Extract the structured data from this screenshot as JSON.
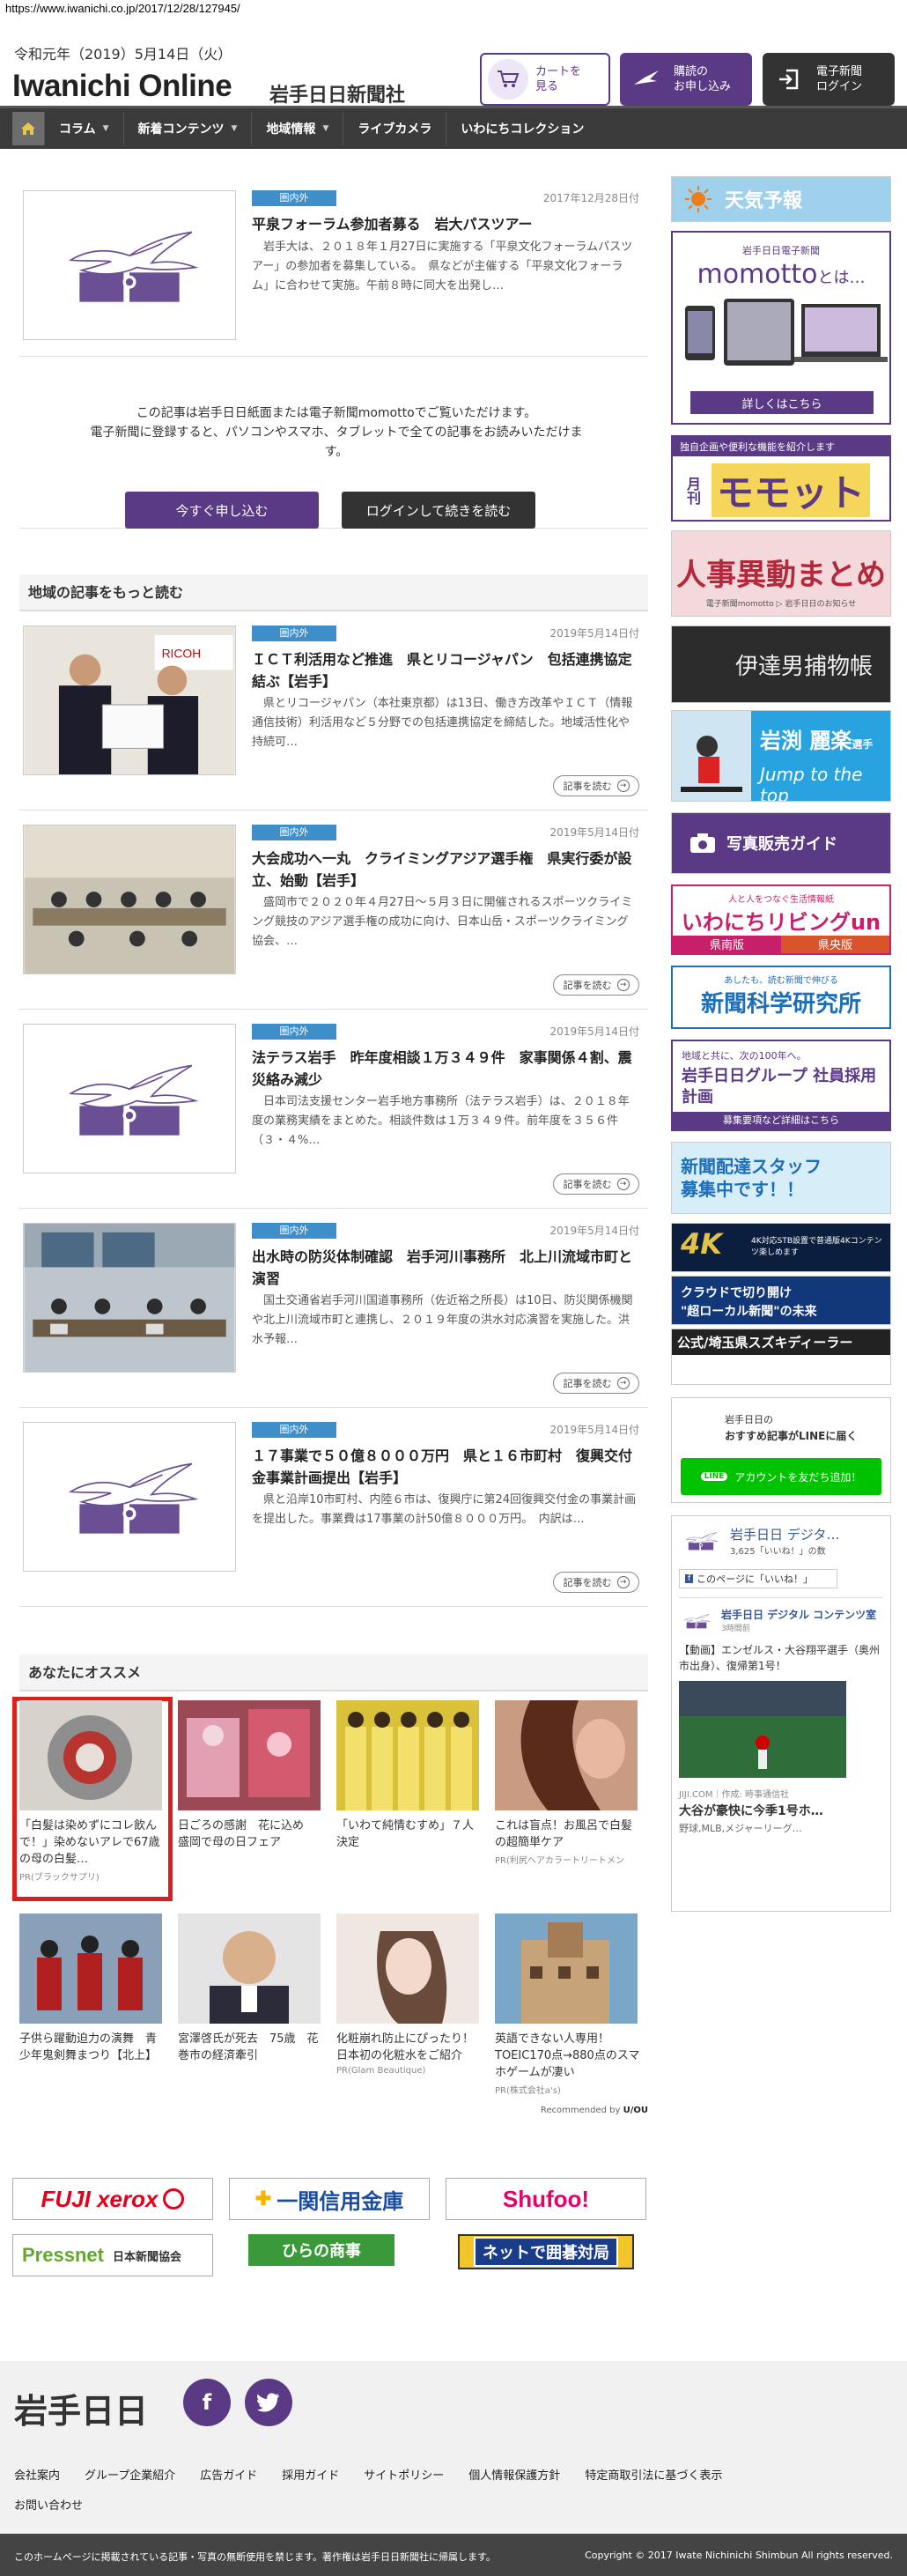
{
  "url": "https://www.iwanichi.co.jp/2017/12/28/127945/",
  "header": {
    "date": "令和元年（2019）5月14日（火）",
    "logo": "Iwanichi Online",
    "logo_sub": "岩手日日新聞社",
    "cart": "カートを\n見る",
    "subscribe": "購読の\nお申し込み",
    "login": "電子新聞\nログイン"
  },
  "nav": {
    "items": [
      {
        "label": "コラム",
        "drop": "▼"
      },
      {
        "label": "新着コンテンツ",
        "drop": "▼"
      },
      {
        "label": "地域情報",
        "drop": "▼"
      },
      {
        "label": "ライブカメラ",
        "drop": ""
      },
      {
        "label": "いわにちコレクション",
        "drop": ""
      }
    ]
  },
  "top_article": {
    "tag": "圏内外",
    "date": "2017年12月28日付",
    "title": "平泉フォーラム参加者募る　岩大パスツアー",
    "body": "岩手大は、２０１８年１月27日に実施する「平泉文化フォーラムパスツアー」の参加者を募集している。　県などが主催する「平泉文化フォーラム」に合わせて実施。午前８時に同大を出発し…"
  },
  "paywall": {
    "text": "この記事は岩手日日紙面または電子新聞momottoでご覧いただけます。\n電子新聞に登録すると、パソコンやスマホ、タブレットで全ての記事をお読みいただけます。",
    "subscribe_btn": "今すぐ申し込む",
    "login_btn": "ログインして続きを読む"
  },
  "region": {
    "heading": "地域の記事をもっと読む",
    "more_label": "記事を読む",
    "articles": [
      {
        "tag": "圏内外",
        "date": "2019年5月14日付",
        "title": "ＩＣＴ利活用など推進　県とリコージャパン　包括連携協定結ぶ【岩手】",
        "body": "県とリコージャパン（本社東京都）は13日、働き方改革やＩＣＴ（情報通信技術）利活用など５分野での包括連携協定を締結した。地域活性化や持続可…"
      },
      {
        "tag": "圏内外",
        "date": "2019年5月14日付",
        "title": "大会成功へ一丸　クライミングアジア選手権　県実行委が設立、始動【岩手】",
        "body": "盛岡市で２０２０年４月27日～５月３日に開催されるスポーツクライミング競技のアジア選手権の成功に向け、日本山岳・スポーツクライミング協会、…"
      },
      {
        "tag": "圏内外",
        "date": "2019年5月14日付",
        "title": "法テラス岩手　昨年度相談１万３４９件　家事関係４割、震災絡み減少",
        "body": "日本司法支援センター岩手地方事務所（法テラス岩手）は、２０１８年度の業務実績をまとめた。相談件数は１万３４９件。前年度を３５６件（３・４%…"
      },
      {
        "tag": "圏内外",
        "date": "2019年5月14日付",
        "title": "出水時の防災体制確認　岩手河川事務所　北上川流域市町と演習",
        "body": "国土交通省岩手河川国道事務所（佐近裕之所長）は10日、防災関係機関や北上川流域市町と連携し、２０１９年度の洪水対応演習を実施した。洪水予報…"
      },
      {
        "tag": "圏内外",
        "date": "2019年5月14日付",
        "title": "１７事業で５０億８０００万円　県と１６市町村　復興交付金事業計画提出【岩手】",
        "body": "県と沿岸10市町村、内陸６市は、復興庁に第24回復興交付金の事業計画を提出した。事業費は17事業の計50億８０００万円。　内訳は…"
      }
    ]
  },
  "recommend": {
    "heading": "あなたにオススメ",
    "credit": "Recommended by",
    "items": [
      {
        "title": "「白髪は染めずにコレ飲んで！」染めないアレで67歳の母の白髪…",
        "pr": "PR(ブラックサプリ)"
      },
      {
        "title": "日ごろの感謝　花に込め　盛岡で母の日フェア",
        "pr": ""
      },
      {
        "title": "「いわて純情むすめ」７人決定",
        "pr": ""
      },
      {
        "title": "これは盲点！お風呂で白髪の超簡単ケア",
        "pr": "PR(利尻ヘアカラートリートメン"
      },
      {
        "title": "子供ら躍動迫力の演舞　青少年鬼剣舞まつり【北上】",
        "pr": ""
      },
      {
        "title": "宮澤啓氏が死去　75歳　花巻市の経済牽引",
        "pr": ""
      },
      {
        "title": "化粧崩れ防止にぴったり！日本初の化粧水をご紹介",
        "pr": "PR(Glam Beautique)"
      },
      {
        "title": "英語できない人専用！TOEIC170点→880点のスマホゲームが凄い",
        "pr": "PR(株式会社a's)"
      }
    ]
  },
  "ads": {
    "fujixerox": "FUJI xerox",
    "ichinoseki": "一関信用金庫",
    "shufoo": "Shufoo!",
    "pressnet": "Pressnet",
    "pressnet_sub": "日本新聞協会",
    "hirano": "ひらの商事",
    "igo": "ネットで囲碁対局"
  },
  "sidebar": {
    "weather": "天気予報",
    "momotto_top": "岩手日日電子新聞",
    "momotto": "momotto",
    "momotto_suffix": "とは…",
    "momotto_link": "詳しくはこちら",
    "gekkan_top": "独自企画や便利な機能を紹介します",
    "gekkan": "月刊",
    "gekkan_title": "モモット",
    "jinji": "人事異動まとめ",
    "jinji_sub": "電子新聞momotto ▷ 岩手日日のお知らせ",
    "date_tora": "伊達男捕物帳",
    "iwabuchi": "岩渕 麗楽",
    "iwabuchi_suffix": "選手",
    "iwabuchi_sub": "Jump to the top",
    "photo": "写真販売ガイド",
    "living_top": "人と人をつなぐ生活情報紙",
    "living": "いわにちリビングun",
    "living_a": "県南版",
    "living_b": "県央版",
    "kagaku_top": "あしたも、読む新聞で伸びる",
    "kagaku": "新聞科学研究所",
    "group_top": "地域と共に、次の100年へ。",
    "group": "岩手日日グループ 社員採用計画",
    "group_link": "募集要項など詳細はこちら",
    "haitatsu": "新聞配達スタッフ\n募集中です！！",
    "tv4k": "4K",
    "tv4k_sub": "4K対応STB設置で普通版4Kコンテンツ楽しめます",
    "cloud": "クラウドで切り開け\n\"超ローカル新聞\"の未来",
    "suzuki": "公式/埼玉県スズキディーラー",
    "line_sub": "岩手日日の",
    "line_title": "おすすめ記事がLINEに届く",
    "line_btn": "アカウントを友だち追加！",
    "fb_page": "岩手日日 デジタ…",
    "fb_likes": "3,625「いいね！」の数",
    "fb_like_btn": "このページに「いいね！」",
    "fb_post_name": "岩手日日 デジタル コンテンツ室",
    "fb_post_time": "3時間前",
    "fb_post_text": "【動画】エンゼルス・大谷翔平選手（奥州市出身）、復帰第1号！",
    "fb_link_src": "JIJI.COM｜作成: 時事通信社",
    "fb_link_title": "大谷が豪快に今季1号ホ…",
    "fb_link_sub": "野球,MLB,メジャーリーグ…"
  },
  "footer": {
    "logo": "岩手日日",
    "links": [
      "会社案内",
      "グループ企業紹介",
      "広告ガイド",
      "採用ガイド",
      "サイトポリシー",
      "個人情報保護方針",
      "特定商取引法に基づく表示",
      "お問い合わせ"
    ],
    "notice": "このホームページに掲載されている記事・写真の無断使用を禁じます。著作権は岩手日日新聞社に帰属します。",
    "copyright": "Copyright © 2017 Iwate Nichinichi Shimbun All rights reserved."
  },
  "colors": {
    "purple": "#5a3a85",
    "tag_blue": "#3d8ec9",
    "nav": "#3b3b3b",
    "rec_border": "#d9201c"
  }
}
